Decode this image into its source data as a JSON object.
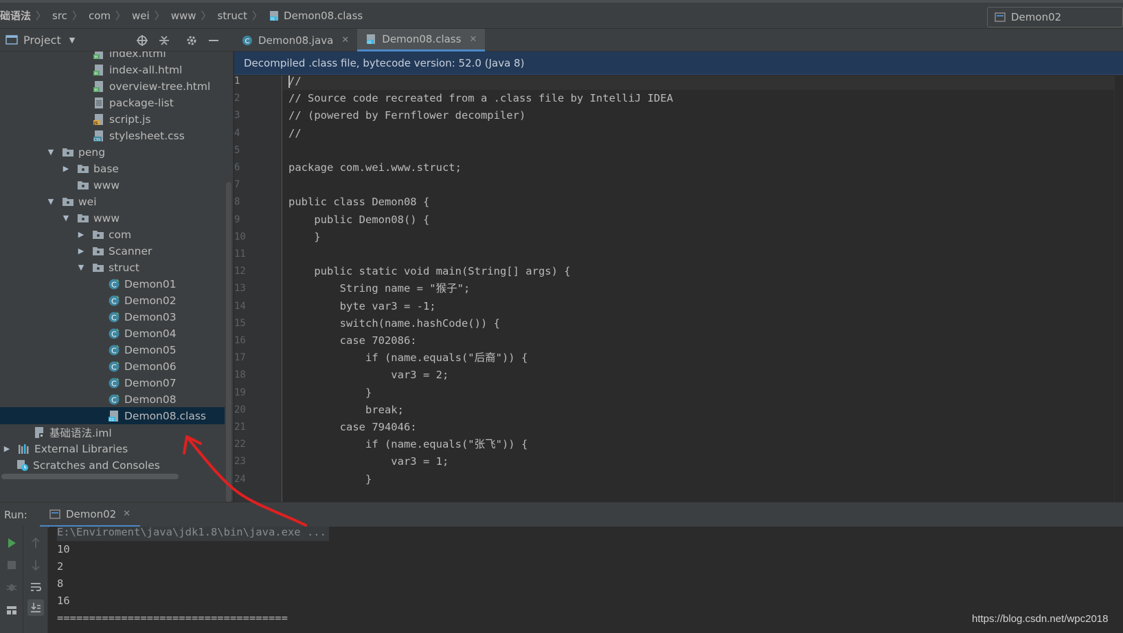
{
  "breadcrumb": {
    "items": [
      "础语法",
      "src",
      "com",
      "wei",
      "www",
      "struct",
      "Demon08.class"
    ]
  },
  "run_config": {
    "label": "Demon02"
  },
  "project_panel": {
    "title": "Project"
  },
  "editor_tabs": [
    {
      "label": "Demon08.java",
      "active": false
    },
    {
      "label": "Demon08.class",
      "active": true
    }
  ],
  "tree": {
    "items": [
      {
        "label": "index.html",
        "type": "html"
      },
      {
        "label": "index-all.html",
        "type": "html"
      },
      {
        "label": "overview-tree.html",
        "type": "html"
      },
      {
        "label": "package-list",
        "type": "file"
      },
      {
        "label": "script.js",
        "type": "js"
      },
      {
        "label": "stylesheet.css",
        "type": "css"
      },
      {
        "label": "peng",
        "type": "package",
        "expanded": true
      },
      {
        "label": "base",
        "type": "package",
        "expanded": false
      },
      {
        "label": "www",
        "type": "package"
      },
      {
        "label": "wei",
        "type": "package",
        "expanded": true
      },
      {
        "label": "www",
        "type": "package",
        "expanded": true
      },
      {
        "label": "com",
        "type": "package",
        "expanded": false
      },
      {
        "label": "Scanner",
        "type": "package",
        "expanded": false
      },
      {
        "label": "struct",
        "type": "package",
        "expanded": true
      },
      {
        "label": "Demon01",
        "type": "class"
      },
      {
        "label": "Demon02",
        "type": "class"
      },
      {
        "label": "Demon03",
        "type": "class"
      },
      {
        "label": "Demon04",
        "type": "class"
      },
      {
        "label": "Demon05",
        "type": "class"
      },
      {
        "label": "Demon06",
        "type": "class"
      },
      {
        "label": "Demon07",
        "type": "class"
      },
      {
        "label": "Demon08",
        "type": "class"
      },
      {
        "label": "Demon08.class",
        "type": "classfile",
        "selected": true
      },
      {
        "label": "基础语法.iml",
        "type": "iml"
      },
      {
        "label": "External Libraries",
        "type": "libraries",
        "expanded": false
      },
      {
        "label": "Scratches and Consoles",
        "type": "scratches"
      }
    ]
  },
  "banner": {
    "text": "Decompiled .class file, bytecode version: 52.0 (Java 8)"
  },
  "editor": {
    "line_numbers": [
      "1",
      "2",
      "3",
      "4",
      "5",
      "6",
      "7",
      "8",
      "9",
      "10",
      "11",
      "12",
      "13",
      "14",
      "15",
      "16",
      "17",
      "18",
      "19",
      "20",
      "21",
      "22",
      "23",
      "24"
    ],
    "lines": [
      "//",
      "// Source code recreated from a .class file by IntelliJ IDEA",
      "// (powered by Fernflower decompiler)",
      "//",
      "",
      "package com.wei.www.struct;",
      "",
      "public class Demon08 {",
      "    public Demon08() {",
      "    }",
      "",
      "    public static void main(String[] args) {",
      "        String name = \"猴子\";",
      "        byte var3 = -1;",
      "        switch(name.hashCode()) {",
      "        case 702086:",
      "            if (name.equals(\"后裔\")) {",
      "                var3 = 2;",
      "            }",
      "            break;",
      "        case 794046:",
      "            if (name.equals(\"张飞\")) {",
      "                var3 = 1;",
      "            }"
    ]
  },
  "run_panel": {
    "label": "Run:",
    "tab": "Demon02",
    "console": [
      "E:\\Enviroment\\java\\jdk1.8\\bin\\java.exe ...",
      "10",
      "2",
      "8",
      "16",
      "===================================="
    ]
  },
  "watermark": "https://blog.csdn.net/wpc2018",
  "colors": {
    "accent": "#4a88c7",
    "selection": "#0d293e",
    "banner": "#223958",
    "annotation": "#e02020"
  }
}
